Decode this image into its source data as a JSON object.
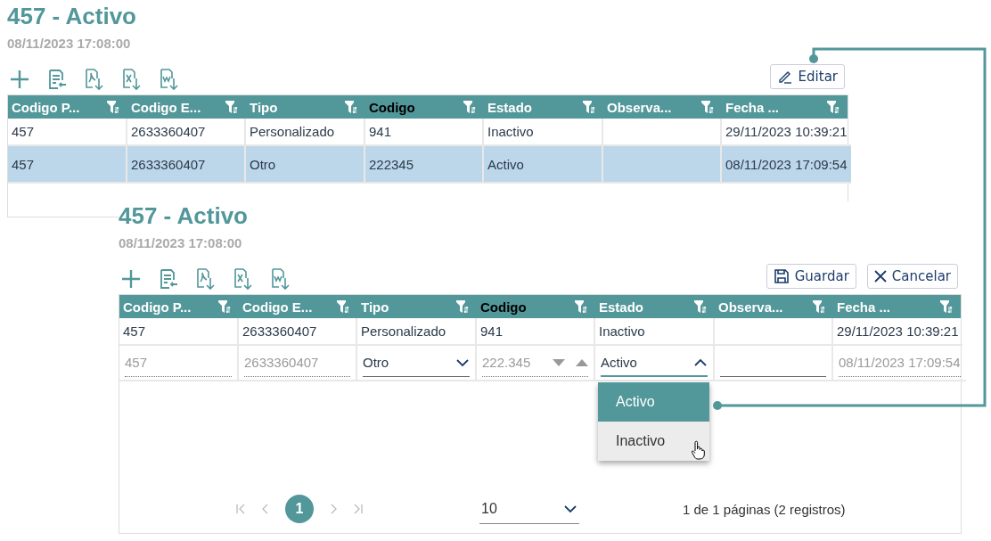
{
  "panels": [
    {
      "title": "457 - Activo",
      "date": "08/11/2023 17:08:00",
      "buttons": [
        {
          "kind": "edit",
          "label": "Editar"
        }
      ],
      "table": {
        "columns": [
          {
            "label": "Codigo P...",
            "color": "#ffffff"
          },
          {
            "label": "Codigo E...",
            "color": "#ffffff"
          },
          {
            "label": "Tipo",
            "color": "#ffffff"
          },
          {
            "label": "Codigo",
            "color": "#000000"
          },
          {
            "label": "Estado",
            "color": "#ffffff"
          },
          {
            "label": "Observa...",
            "color": "#ffffff"
          },
          {
            "label": "Fecha ...",
            "color": "#ffffff"
          }
        ],
        "rows": [
          {
            "selected": false,
            "editing": false,
            "cells": [
              {
                "text": "457"
              },
              {
                "text": "2633360407"
              },
              {
                "text": "Personalizado"
              },
              {
                "text": "941"
              },
              {
                "text": "Inactivo"
              },
              {
                "text": ""
              },
              {
                "text": "29/11/2023 10:39:21"
              }
            ]
          },
          {
            "selected": true,
            "editing": false,
            "cells": [
              {
                "text": "457"
              },
              {
                "text": "2633360407"
              },
              {
                "text": "Otro"
              },
              {
                "text": "222345"
              },
              {
                "text": "Activo"
              },
              {
                "text": ""
              },
              {
                "text": "08/11/2023 17:09:54"
              }
            ]
          }
        ]
      }
    },
    {
      "title": "457 - Activo",
      "date": "08/11/2023 17:08:00",
      "buttons": [
        {
          "kind": "save",
          "label": "Guardar"
        },
        {
          "kind": "cancel",
          "label": "Cancelar"
        }
      ],
      "table": {
        "columns": [
          {
            "label": "Codigo P...",
            "color": "#ffffff"
          },
          {
            "label": "Codigo E...",
            "color": "#ffffff"
          },
          {
            "label": "Tipo",
            "color": "#ffffff"
          },
          {
            "label": "Codigo",
            "color": "#000000"
          },
          {
            "label": "Estado",
            "color": "#ffffff"
          },
          {
            "label": "Observa...",
            "color": "#ffffff"
          },
          {
            "label": "Fecha ...",
            "color": "#ffffff"
          }
        ],
        "rows": [
          {
            "selected": false,
            "editing": false,
            "cells": [
              {
                "text": "457"
              },
              {
                "text": "2633360407"
              },
              {
                "text": "Personalizado"
              },
              {
                "text": "941"
              },
              {
                "text": "Inactivo"
              },
              {
                "text": ""
              },
              {
                "text": "29/11/2023 10:39:21"
              }
            ]
          },
          {
            "selected": false,
            "editing": true,
            "cells": [
              {
                "kind": "readonly",
                "text": "457"
              },
              {
                "kind": "readonly",
                "text": "2633360407"
              },
              {
                "kind": "select",
                "text": "Otro"
              },
              {
                "kind": "spinner",
                "text": "222.345"
              },
              {
                "kind": "select-open",
                "text": "Activo"
              },
              {
                "kind": "input",
                "text": ""
              },
              {
                "kind": "readonly",
                "text": "08/11/2023 17:09:54"
              }
            ]
          }
        ]
      },
      "dropdown": {
        "options": [
          {
            "label": "Activo",
            "selected": true,
            "hovered": false
          },
          {
            "label": "Inactivo",
            "selected": false,
            "hovered": true
          }
        ]
      },
      "pager": {
        "pages": [
          {
            "label": "1",
            "selected": true
          }
        ],
        "page_size": "10",
        "info": "1 de 1 páginas (2 registros)"
      }
    }
  ]
}
